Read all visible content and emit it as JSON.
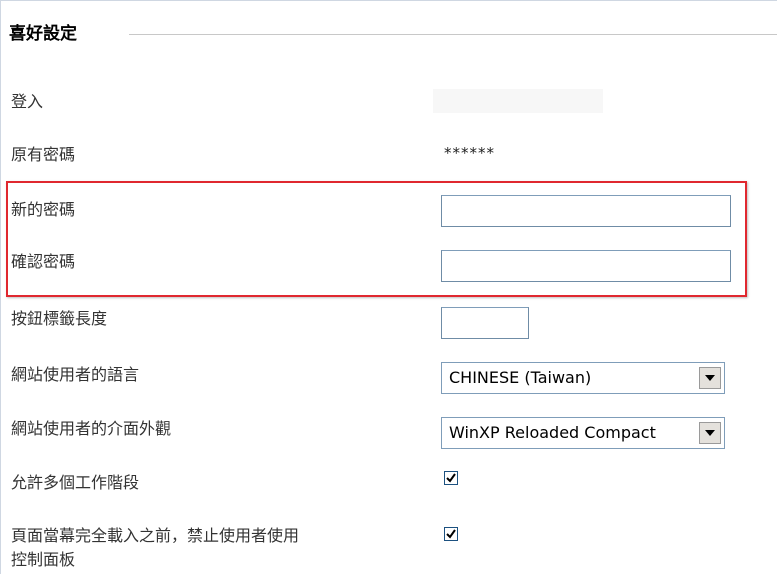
{
  "section": {
    "title": "喜好設定"
  },
  "fields": {
    "login": {
      "label": "登入",
      "value": ""
    },
    "old_password": {
      "label": "原有密碼",
      "value": "******"
    },
    "new_password": {
      "label": "新的密碼",
      "value": ""
    },
    "confirm_password": {
      "label": "確認密碼",
      "value": ""
    },
    "button_label_length": {
      "label": "按鈕標籤長度",
      "value": ""
    },
    "site_language": {
      "label": "網站使用者的語言",
      "selected": "CHINESE (Taiwan)"
    },
    "site_theme": {
      "label": "網站使用者的介面外觀",
      "selected": "WinXP Reloaded Compact"
    },
    "allow_multiple_sessions": {
      "label": "允許多個工作階段",
      "checked": true
    },
    "block_control_panel": {
      "label_line1": "頁面當幕完全載入之前，禁止使用者使用",
      "label_line2": "控制面板",
      "checked": true
    }
  },
  "colors": {
    "highlight_border": "#e0282f",
    "input_border": "#7f9db9",
    "checkbox_border": "#1c5180"
  }
}
